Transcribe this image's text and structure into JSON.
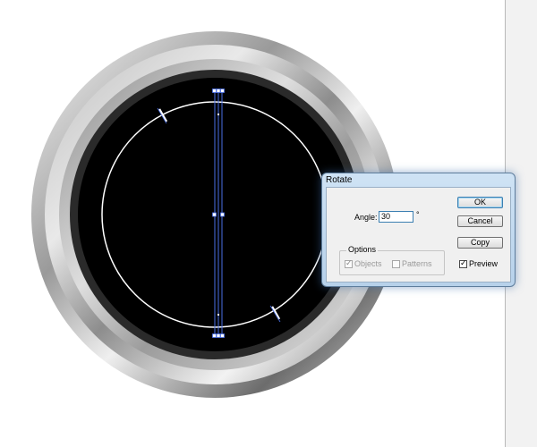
{
  "dialog": {
    "title": "Rotate",
    "angle_label": "Angle:",
    "angle_value": "30",
    "degree_symbol": "°",
    "options_label": "Options",
    "objects_label": "Objects",
    "objects_checked": true,
    "patterns_label": "Patterns",
    "patterns_checked": false,
    "preview_label": "Preview",
    "preview_checked": true,
    "buttons": {
      "ok": "OK",
      "cancel": "Cancel",
      "copy": "Copy"
    }
  },
  "colors": {
    "selection_blue": "#4a6fe6",
    "dial_face": "#000000",
    "guide_circle": "#ffffff",
    "dialog_frame": "#b7d1ea"
  }
}
